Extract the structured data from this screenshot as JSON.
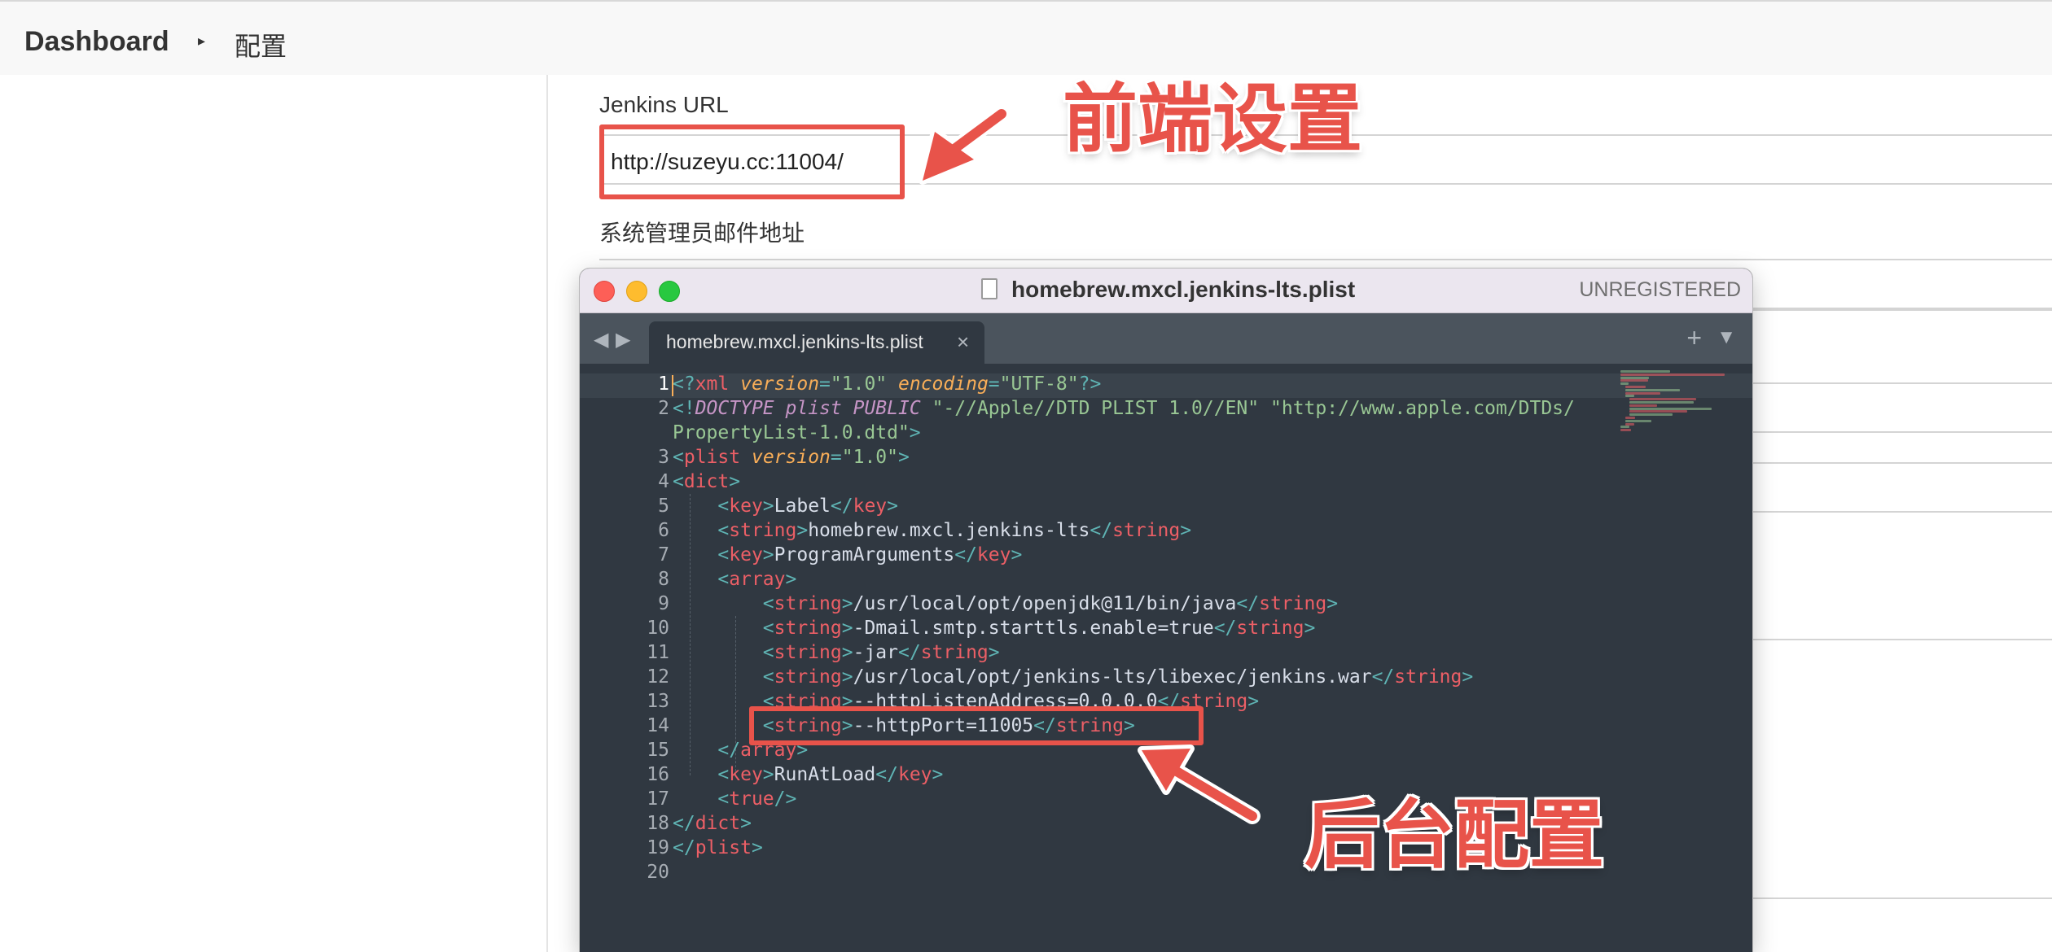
{
  "breadcrumb": {
    "dashboard": "Dashboard",
    "separator": "▸",
    "current": "配置"
  },
  "form": {
    "jenkins_url_label": "Jenkins URL",
    "jenkins_url_value": "http://suzeyu.cc:11004/",
    "admin_email_label": "系统管理员邮件地址"
  },
  "editor": {
    "window_title": "homebrew.mxcl.jenkins-lts.plist",
    "unregistered": "UNREGISTERED",
    "tab_label": "homebrew.mxcl.jenkins-lts.plist",
    "tab_close": "×",
    "nav_back": "◀",
    "nav_forward": "▶",
    "new_tab": "+",
    "tab_menu": "▼",
    "line_numbers": [
      "1",
      "2",
      "",
      "3",
      "4",
      "5",
      "6",
      "7",
      "8",
      "9",
      "10",
      "11",
      "12",
      "13",
      "14",
      "15",
      "16",
      "17",
      "18",
      "19",
      "20"
    ],
    "lines": [
      "<?xml version=\"1.0\" encoding=\"UTF-8\"?>",
      "<!DOCTYPE plist PUBLIC \"-//Apple//DTD PLIST 1.0//EN\" \"http://www.apple.com/DTDs/",
      "PropertyList-1.0.dtd\">",
      "<plist version=\"1.0\">",
      "<dict>",
      "    <key>Label</key>",
      "    <string>homebrew.mxcl.jenkins-lts</string>",
      "    <key>ProgramArguments</key>",
      "    <array>",
      "        <string>/usr/local/opt/openjdk@11/bin/java</string>",
      "        <string>-Dmail.smtp.starttls.enable=true</string>",
      "        <string>-jar</string>",
      "        <string>/usr/local/opt/jenkins-lts/libexec/jenkins.war</string>",
      "        <string>--httpListenAddress=0.0.0.0</string>",
      "        <string>--httpPort=11005</string>",
      "    </array>",
      "    <key>RunAtLoad</key>",
      "    <true/>",
      "</dict>",
      "</plist>",
      ""
    ]
  },
  "annotations": {
    "frontend_label": "前端设置",
    "backend_label": "后台配置"
  },
  "colors": {
    "annotation_red": "#e8534a",
    "editor_bg": "#303841",
    "tag_name": "#ec5f66",
    "bracket": "#5fb4b4",
    "string": "#99c794",
    "attribute": "#f9ae58"
  }
}
